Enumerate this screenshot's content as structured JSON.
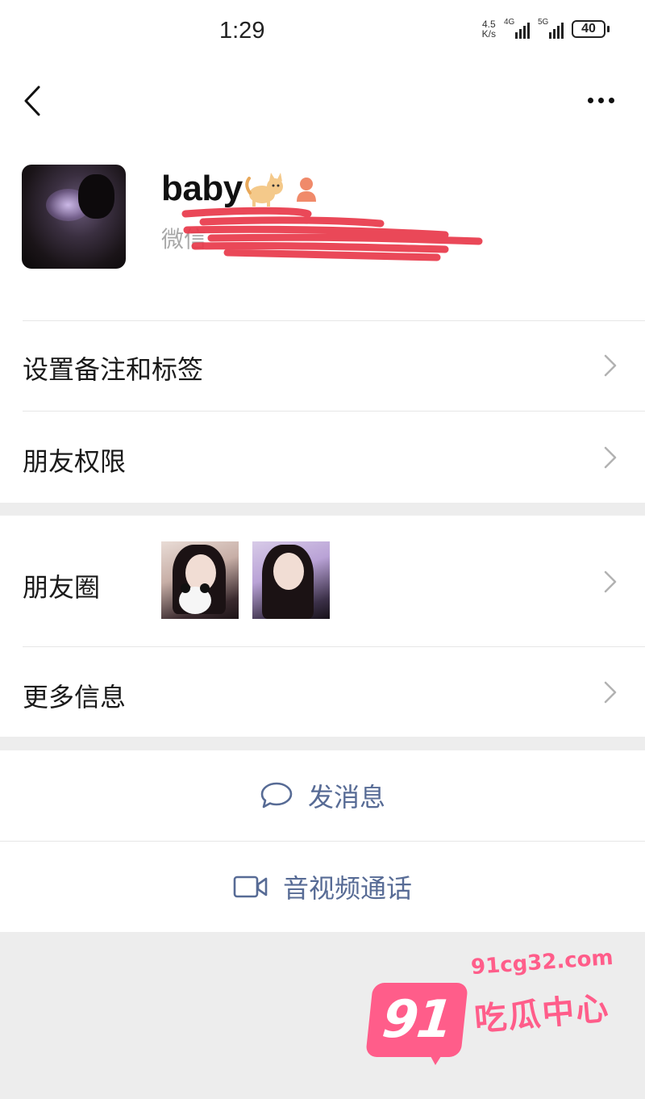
{
  "status_bar": {
    "time": "1:29",
    "net_speed_value": "4.5",
    "net_speed_unit": "K/s",
    "signal_1": "4G",
    "signal_2": "5G",
    "battery": "40"
  },
  "nav": {
    "back_icon": "chevron-left-icon",
    "more_icon": "more-dots-icon"
  },
  "profile": {
    "nickname": "baby",
    "emoji_icon": "cat-icon",
    "gender_icon": "female-icon",
    "id_label": "微信"
  },
  "rows": {
    "remark_label": "设置备注和标签",
    "permissions_label": "朋友权限",
    "moments_label": "朋友圈",
    "more_info_label": "更多信息"
  },
  "actions": {
    "message_label": "发消息",
    "message_icon": "chat-bubble-icon",
    "video_call_label": "音视频通话",
    "video_call_icon": "video-camera-icon",
    "accent_color": "#576b95"
  },
  "watermark": {
    "number": "91",
    "url": "91cg32.com",
    "text": "吃瓜中心",
    "color": "#ff5d8a"
  }
}
